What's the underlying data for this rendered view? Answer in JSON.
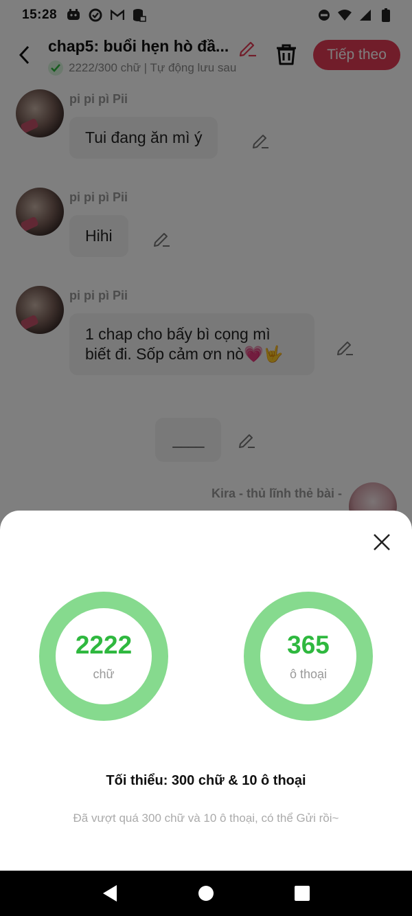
{
  "status_bar": {
    "time": "15:28",
    "left_icons": [
      "game-controller-icon",
      "sync-icon",
      "gmail-icon",
      "database-icon"
    ],
    "right_icons": [
      "do-not-disturb-icon",
      "wifi-icon",
      "signal-icon",
      "battery-icon"
    ]
  },
  "header": {
    "title": "chap5: buổi hẹn hò đầ...",
    "subtitle": "2222/300 chữ | Tự động lưu sau",
    "next_label": "Tiếp theo"
  },
  "messages": [
    {
      "sender": "pi pi pì Pii",
      "text": "Tui đang ăn mì ý"
    },
    {
      "sender": "pi pi pì Pii",
      "text": "Hihi"
    },
    {
      "sender": "pi pi pì Pii",
      "text": "1 chap cho bấy bì cọng mì biết đi. Sốp cảm ơn nò💗🤟"
    },
    {
      "sender": "",
      "text": "____"
    },
    {
      "sender": "Kira - thủ lĩnh thẻ bài -",
      "text": ""
    }
  ],
  "sheet": {
    "words_value": "2222",
    "words_label": "chữ",
    "dialogs_value": "365",
    "dialogs_label": "ô thoại",
    "minimum": "Tối thiểu: 300 chữ & 10 ô thoại",
    "note": "Đã vượt quá 300 chữ và 10 ô thoại, có thể Gửi rồi~"
  },
  "colors": {
    "accent": "#e33a55",
    "ring": "#86da8e",
    "ring_text": "#2fb83f",
    "check_bg": "#d9f5dc"
  }
}
